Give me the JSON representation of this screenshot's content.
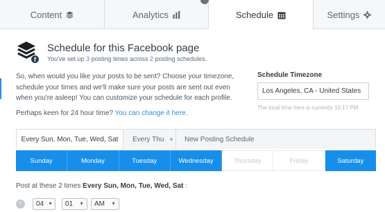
{
  "tabs": {
    "content": "Content",
    "analytics": "Analytics",
    "schedule": "Schedule",
    "settings": "Settings"
  },
  "header": {
    "title": "Schedule for this Facebook page",
    "subtitle_pre": "You've set up ",
    "subtitle_count_times": "3",
    "subtitle_mid": " posting times across ",
    "subtitle_count_schedules": "2",
    "subtitle_post": " posting schedules.",
    "profile_badge": "f"
  },
  "description": "So, when would you like your posts to be sent? Choose your timezone, schedule your times and we'll make sure your posts are sent out even when you're asleep! You can customize your schedule for each profile.",
  "hint": {
    "text": "Perhaps keen for 24 hour time? ",
    "link": "You can change it here."
  },
  "timezone": {
    "label": "Schedule Timezone",
    "value": "Los Angeles, CA - United States",
    "note": "The local time here is currently 10:17 PM"
  },
  "schedule_tabs": {
    "active": "Every Sun, Mon, Tue, Wed, Sat",
    "second": "Every Thu",
    "close": "×",
    "new": "New Posting Schedule"
  },
  "days": [
    {
      "label": "Sunday",
      "on": true
    },
    {
      "label": "Monday",
      "on": true
    },
    {
      "label": "Tuesday",
      "on": true
    },
    {
      "label": "Wednesday",
      "on": true
    },
    {
      "label": "Thursday",
      "on": false
    },
    {
      "label": "Friday",
      "on": false
    },
    {
      "label": "Saturday",
      "on": true
    }
  ],
  "post_at": {
    "pre": "Post at these 2 times ",
    "days": "Every Sun, Mon, Tue, Wed, Sat",
    "post": " :"
  },
  "time": {
    "hour": "04",
    "minute": "01",
    "ampm": "AM"
  },
  "colors": {
    "accent": "#168eea",
    "link": "#2c8ce0"
  }
}
